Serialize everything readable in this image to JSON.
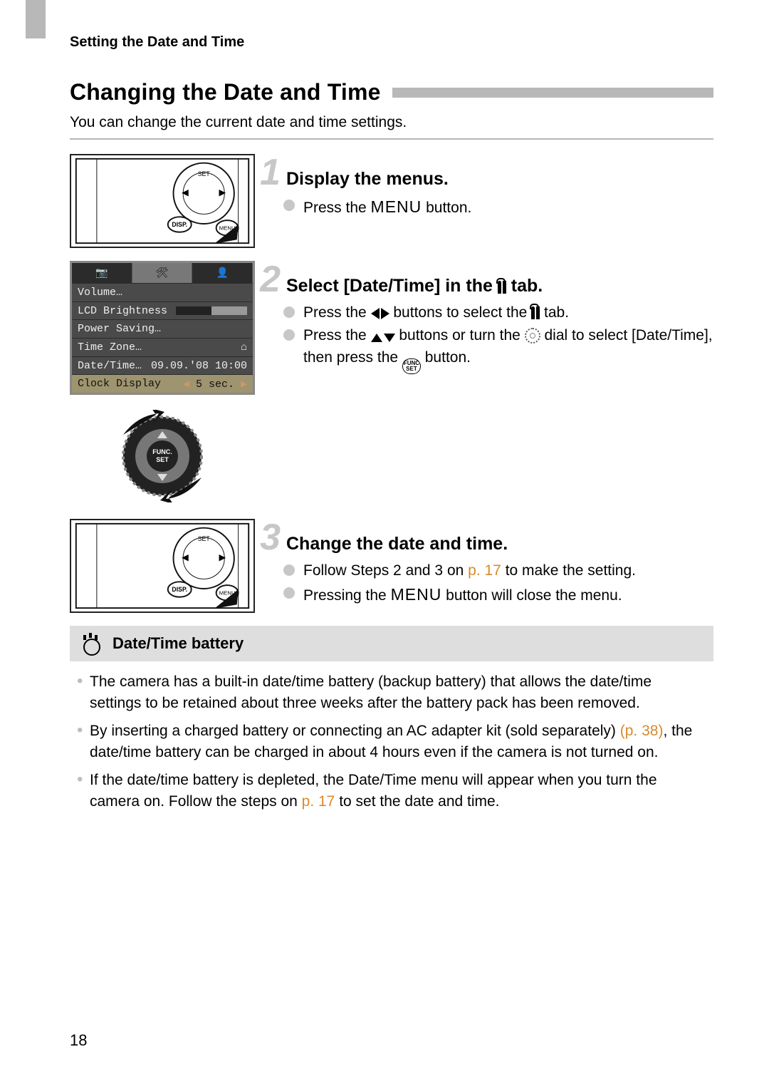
{
  "breadcrumb": "Setting the Date and Time",
  "section_title": "Changing the Date and Time",
  "section_intro": "You can change the current date and time settings.",
  "steps": {
    "s1": {
      "num": "1",
      "title": "Display the menus.",
      "b1_pre": "Press the ",
      "b1_menu": "MENU",
      "b1_post": " button."
    },
    "s2": {
      "num": "2",
      "title_pre": "Select [Date/Time] in the ",
      "title_post": " tab.",
      "b1_pre": "Press the ",
      "b1_mid": " buttons to select the ",
      "b1_post": " tab.",
      "b2_pre": "Press the ",
      "b2_mid": " buttons or turn the ",
      "b2_mid2": " dial to select [Date/Time], then press the ",
      "b2_func1": "FUNC",
      "b2_func2": "SET",
      "b2_post": " button."
    },
    "s3": {
      "num": "3",
      "title": "Change the date and time.",
      "b1_pre": "Follow Steps 2 and 3 on ",
      "b1_link": "p. 17",
      "b1_post": " to make the setting.",
      "b2_pre": "Pressing the ",
      "b2_menu": "MENU",
      "b2_post": " button will close the menu."
    }
  },
  "lcd": {
    "tabs": {
      "cam": "▣",
      "tools": "⚒",
      "user": "👤"
    },
    "rows": {
      "volume": {
        "label": "Volume…"
      },
      "brightness": {
        "label": "LCD Brightness"
      },
      "power": {
        "label": "Power Saving…"
      },
      "timezone": {
        "label": "Time Zone…",
        "value": "⌂"
      },
      "datetime": {
        "label": "Date/Time…",
        "value": "09.09.'08 10:00"
      },
      "clock": {
        "label": "Clock Display",
        "value": "5 sec."
      }
    }
  },
  "callout": {
    "title": "Date/Time battery",
    "i1": "The camera has a built-in date/time battery (backup battery) that allows the date/time settings to be retained about three weeks after the battery pack has been removed.",
    "i2_pre": "By inserting a charged battery or connecting an AC adapter kit (sold separately) ",
    "i2_link": "(p. 38)",
    "i2_post": ", the date/time battery can be charged in about 4 hours even if the camera is not turned on.",
    "i3_pre": "If the date/time battery is depleted, the Date/Time menu will appear when you turn the camera on. Follow the steps on ",
    "i3_link": "p. 17",
    "i3_post": " to set the date and time."
  },
  "page_number": "18"
}
